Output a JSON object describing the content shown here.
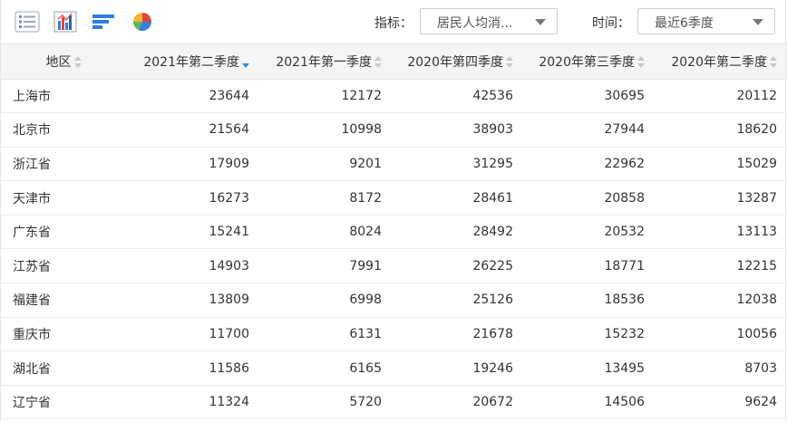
{
  "toolbar": {
    "icons": [
      "table-view-icon",
      "bar-chart-icon",
      "horizontal-bar-chart-icon",
      "pie-chart-icon"
    ],
    "indicator_label": "指标：",
    "indicator_value": "居民人均消...",
    "time_label": "时间：",
    "time_value": "最近6季度"
  },
  "table": {
    "columns": [
      "地区",
      "2021年第二季度",
      "2021年第一季度",
      "2020年第四季度",
      "2020年第三季度",
      "2020年第二季度"
    ],
    "sorted_column": 1,
    "rows": [
      {
        "region": "上海市",
        "values": [
          "23644",
          "12172",
          "42536",
          "30695",
          "20112"
        ]
      },
      {
        "region": "北京市",
        "values": [
          "21564",
          "10998",
          "38903",
          "27944",
          "18620"
        ]
      },
      {
        "region": "浙江省",
        "values": [
          "17909",
          "9201",
          "31295",
          "22962",
          "15029"
        ]
      },
      {
        "region": "天津市",
        "values": [
          "16273",
          "8172",
          "28461",
          "20858",
          "13287"
        ]
      },
      {
        "region": "广东省",
        "values": [
          "15241",
          "8024",
          "28492",
          "20532",
          "13113"
        ]
      },
      {
        "region": "江苏省",
        "values": [
          "14903",
          "7991",
          "26225",
          "18771",
          "12215"
        ]
      },
      {
        "region": "福建省",
        "values": [
          "13809",
          "6998",
          "25126",
          "18536",
          "12038"
        ]
      },
      {
        "region": "重庆市",
        "values": [
          "11700",
          "6131",
          "21678",
          "15232",
          "10056"
        ]
      },
      {
        "region": "湖北省",
        "values": [
          "11586",
          "6165",
          "19246",
          "13495",
          "8703"
        ]
      },
      {
        "region": "辽宁省",
        "values": [
          "11324",
          "5720",
          "20672",
          "14506",
          "9624"
        ]
      }
    ]
  },
  "colors": {
    "accent": "#2d8bd6",
    "header_bg": "#f5f5f5",
    "border": "#e4e4e4"
  }
}
